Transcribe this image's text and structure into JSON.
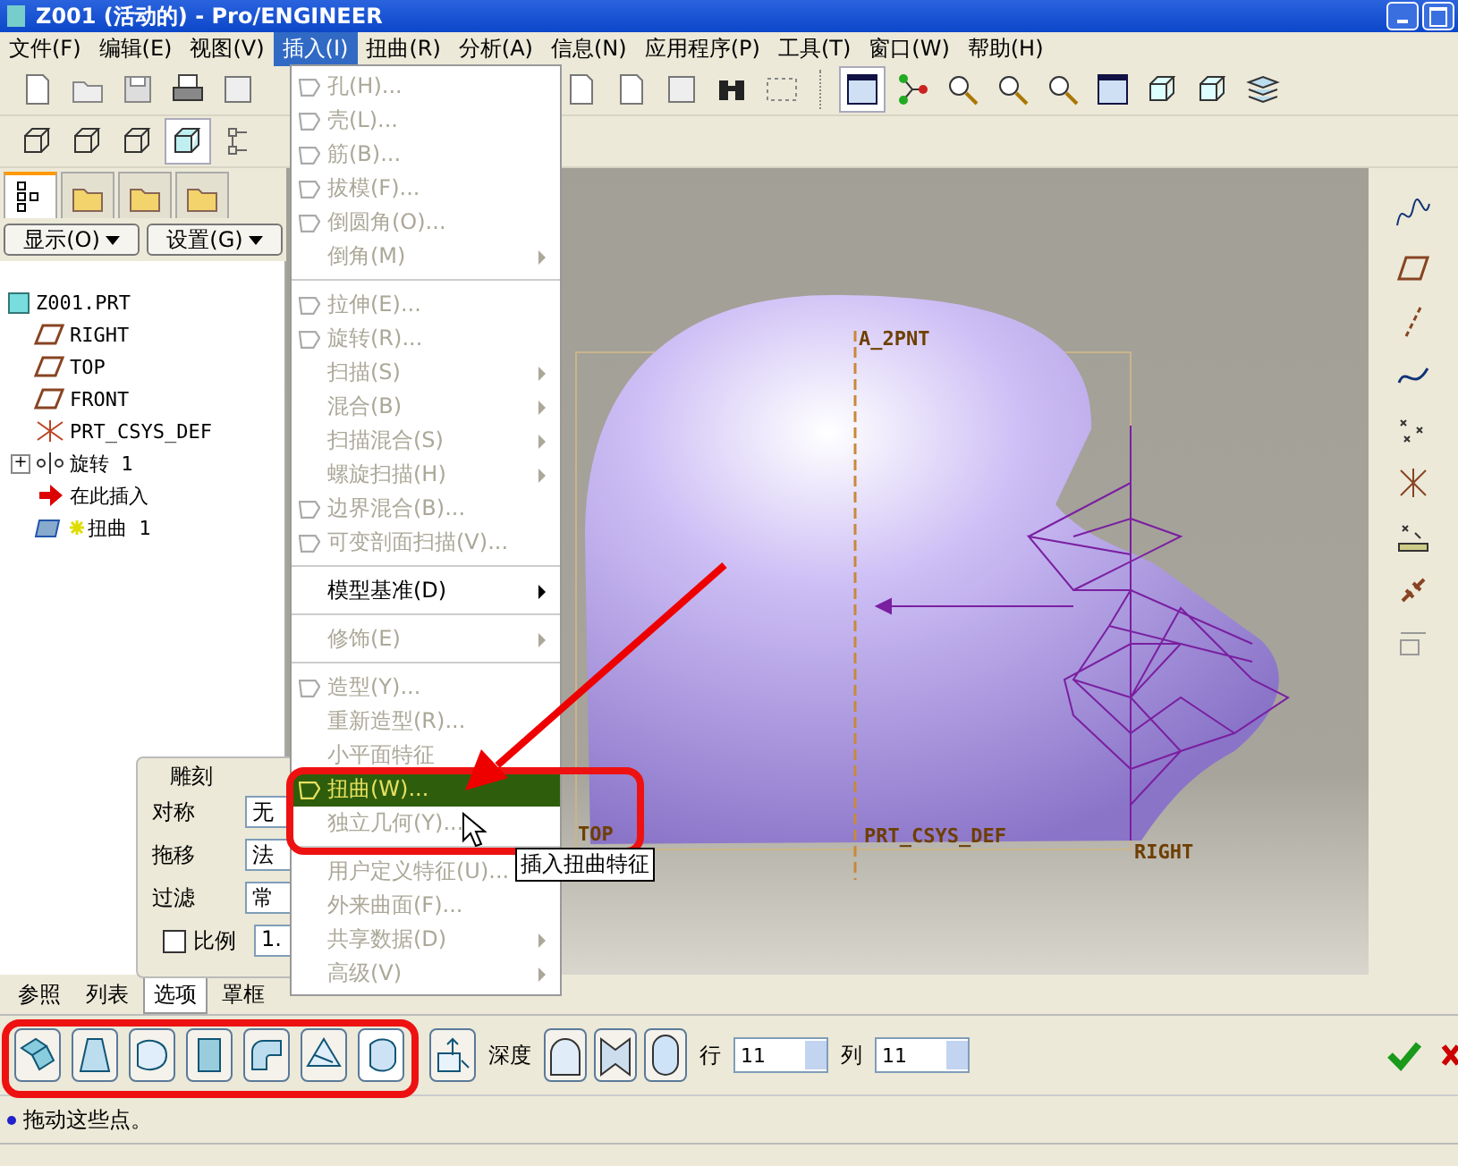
{
  "window": {
    "title": "Z001 (活动的) - Pro/ENGINEER"
  },
  "menu_bar": [
    {
      "label": "文件(F)",
      "selected": false
    },
    {
      "label": "编辑(E)",
      "selected": false
    },
    {
      "label": "视图(V)",
      "selected": false
    },
    {
      "label": "插入(I)",
      "selected": true
    },
    {
      "label": "扭曲(R)",
      "selected": false
    },
    {
      "label": "分析(A)",
      "selected": false
    },
    {
      "label": "信息(N)",
      "selected": false
    },
    {
      "label": "应用程序(P)",
      "selected": false
    },
    {
      "label": "工具(T)",
      "selected": false
    },
    {
      "label": "窗口(W)",
      "selected": false
    },
    {
      "label": "帮助(H)",
      "selected": false
    }
  ],
  "toolbar_1": [
    {
      "selected": false
    },
    {
      "selected": false
    },
    {
      "selected": false
    },
    {
      "selected": false
    },
    {
      "selected": false
    },
    {
      "selected": false
    },
    {
      "selected": false
    },
    {
      "selected": false
    },
    {
      "selected": false
    },
    {
      "selected": false
    },
    {
      "selected": true
    },
    {
      "selected": false
    },
    {
      "selected": false
    },
    {
      "selected": false
    },
    {
      "selected": false
    },
    {
      "selected": false
    },
    {
      "selected": false
    },
    {
      "selected": false
    },
    {
      "selected": false
    }
  ],
  "toolbar_2": [
    {
      "selected": false
    },
    {
      "selected": false
    },
    {
      "selected": false
    },
    {
      "selected": true
    },
    {
      "selected": false
    }
  ],
  "panel_tabs": [
    {
      "selected": true
    },
    {
      "selected": false
    },
    {
      "selected": false
    },
    {
      "selected": false
    }
  ],
  "panel_buttons": [
    {
      "label": "显示(O)"
    },
    {
      "label": "设置(G)"
    }
  ],
  "model_tree": {
    "label": "Z001.PRT",
    "children": [
      {
        "label": "RIGHT",
        "kind": "plane",
        "starred": false
      },
      {
        "label": "TOP",
        "kind": "plane",
        "starred": false
      },
      {
        "label": "FRONT",
        "kind": "plane",
        "starred": false
      },
      {
        "label": "PRT_CSYS_DEF",
        "kind": "csys",
        "starred": false
      },
      {
        "label": "旋转 1",
        "kind": "revolve",
        "toggle": "+",
        "starred": false
      },
      {
        "label": "在此插入",
        "kind": "insert",
        "starred": false
      },
      {
        "label": "扭曲 1",
        "kind": "warp",
        "starred": true
      }
    ]
  },
  "sculpt_panel": {
    "title": "雕刻",
    "rows": [
      {
        "label": "对称",
        "value": "无"
      },
      {
        "label": "拖移",
        "value": "法"
      },
      {
        "label": "过滤",
        "value": "常"
      }
    ],
    "scale": {
      "label": "比例",
      "checked": false,
      "value": "1."
    }
  },
  "insert_menu": [
    {
      "kind": "item",
      "label": "孔(H)...",
      "disabled": true,
      "icon": true,
      "submenu": false,
      "highlighted": false
    },
    {
      "kind": "item",
      "label": "壳(L)...",
      "disabled": true,
      "icon": true,
      "submenu": false,
      "highlighted": false
    },
    {
      "kind": "item",
      "label": "筋(B)...",
      "disabled": true,
      "icon": true,
      "submenu": false,
      "highlighted": false
    },
    {
      "kind": "item",
      "label": "拔模(F)...",
      "disabled": true,
      "icon": true,
      "submenu": false,
      "highlighted": false
    },
    {
      "kind": "item",
      "label": "倒圆角(O)...",
      "disabled": true,
      "icon": true,
      "submenu": false,
      "highlighted": false
    },
    {
      "kind": "item",
      "label": "倒角(M)",
      "disabled": true,
      "icon": false,
      "submenu": true,
      "highlighted": false
    },
    {
      "kind": "separator"
    },
    {
      "kind": "item",
      "label": "拉伸(E)...",
      "disabled": true,
      "icon": true,
      "submenu": false,
      "highlighted": false
    },
    {
      "kind": "item",
      "label": "旋转(R)...",
      "disabled": true,
      "icon": true,
      "submenu": false,
      "highlighted": false
    },
    {
      "kind": "item",
      "label": "扫描(S)",
      "disabled": true,
      "icon": false,
      "submenu": true,
      "highlighted": false
    },
    {
      "kind": "item",
      "label": "混合(B)",
      "disabled": true,
      "icon": false,
      "submenu": true,
      "highlighted": false
    },
    {
      "kind": "item",
      "label": "扫描混合(S)",
      "disabled": true,
      "icon": false,
      "submenu": true,
      "highlighted": false
    },
    {
      "kind": "item",
      "label": "螺旋扫描(H)",
      "disabled": true,
      "icon": false,
      "submenu": true,
      "highlighted": false
    },
    {
      "kind": "item",
      "label": "边界混合(B)...",
      "disabled": true,
      "icon": true,
      "submenu": false,
      "highlighted": false
    },
    {
      "kind": "item",
      "label": "可变剖面扫描(V)...",
      "disabled": true,
      "icon": true,
      "submenu": false,
      "highlighted": false
    },
    {
      "kind": "separator"
    },
    {
      "kind": "item",
      "label": "模型基准(D)",
      "disabled": false,
      "icon": false,
      "submenu": true,
      "highlighted": false
    },
    {
      "kind": "separator"
    },
    {
      "kind": "item",
      "label": "修饰(E)",
      "disabled": true,
      "icon": false,
      "submenu": true,
      "highlighted": false
    },
    {
      "kind": "separator"
    },
    {
      "kind": "item",
      "label": "造型(Y)...",
      "disabled": true,
      "icon": true,
      "submenu": false,
      "highlighted": false
    },
    {
      "kind": "item",
      "label": "重新造型(R)...",
      "disabled": true,
      "icon": false,
      "submenu": false,
      "highlighted": false
    },
    {
      "kind": "item",
      "label": "小平面特征",
      "disabled": true,
      "icon": false,
      "submenu": false,
      "highlighted": false
    },
    {
      "kind": "item",
      "label": "扭曲(W)...",
      "disabled": false,
      "icon": true,
      "submenu": false,
      "highlighted": true
    },
    {
      "kind": "item",
      "label": "独立几何(Y)...",
      "disabled": true,
      "icon": false,
      "submenu": false,
      "highlighted": false
    },
    {
      "kind": "separator"
    },
    {
      "kind": "item",
      "label": "用户定义特征(U)...",
      "disabled": true,
      "icon": false,
      "submenu": false,
      "highlighted": false
    },
    {
      "kind": "item",
      "label": "外来曲面(F)...",
      "disabled": true,
      "icon": false,
      "submenu": false,
      "highlighted": false
    },
    {
      "kind": "item",
      "label": "共享数据(D)",
      "disabled": true,
      "icon": false,
      "submenu": true,
      "highlighted": false
    },
    {
      "kind": "item",
      "label": "高级(V)",
      "disabled": true,
      "icon": false,
      "submenu": true,
      "highlighted": false
    }
  ],
  "tooltip": "插入扭曲特征",
  "datum_labels": [
    "A_2PNT",
    "TOP",
    "PRT_CSYS_DEF",
    "RIGHT"
  ],
  "bottom_tabs": [
    {
      "label": "参照",
      "selected": false
    },
    {
      "label": "列表",
      "selected": false
    },
    {
      "label": "选项",
      "selected": true
    },
    {
      "label": "罩框",
      "selected": false
    }
  ],
  "dashboard": {
    "mode_buttons": [
      {
        "selected": false
      },
      {
        "selected": false
      },
      {
        "selected": false
      },
      {
        "selected": false
      },
      {
        "selected": false
      },
      {
        "selected": false
      },
      {
        "selected": true
      }
    ],
    "depth_label": "深度",
    "depth_buttons": [
      {
        "selected": false
      },
      {
        "selected": false
      },
      {
        "selected": false
      }
    ],
    "rows": {
      "label": "行",
      "value": "11"
    },
    "columns": {
      "label": "列",
      "value": "11"
    }
  },
  "message": "拖动这些点。"
}
